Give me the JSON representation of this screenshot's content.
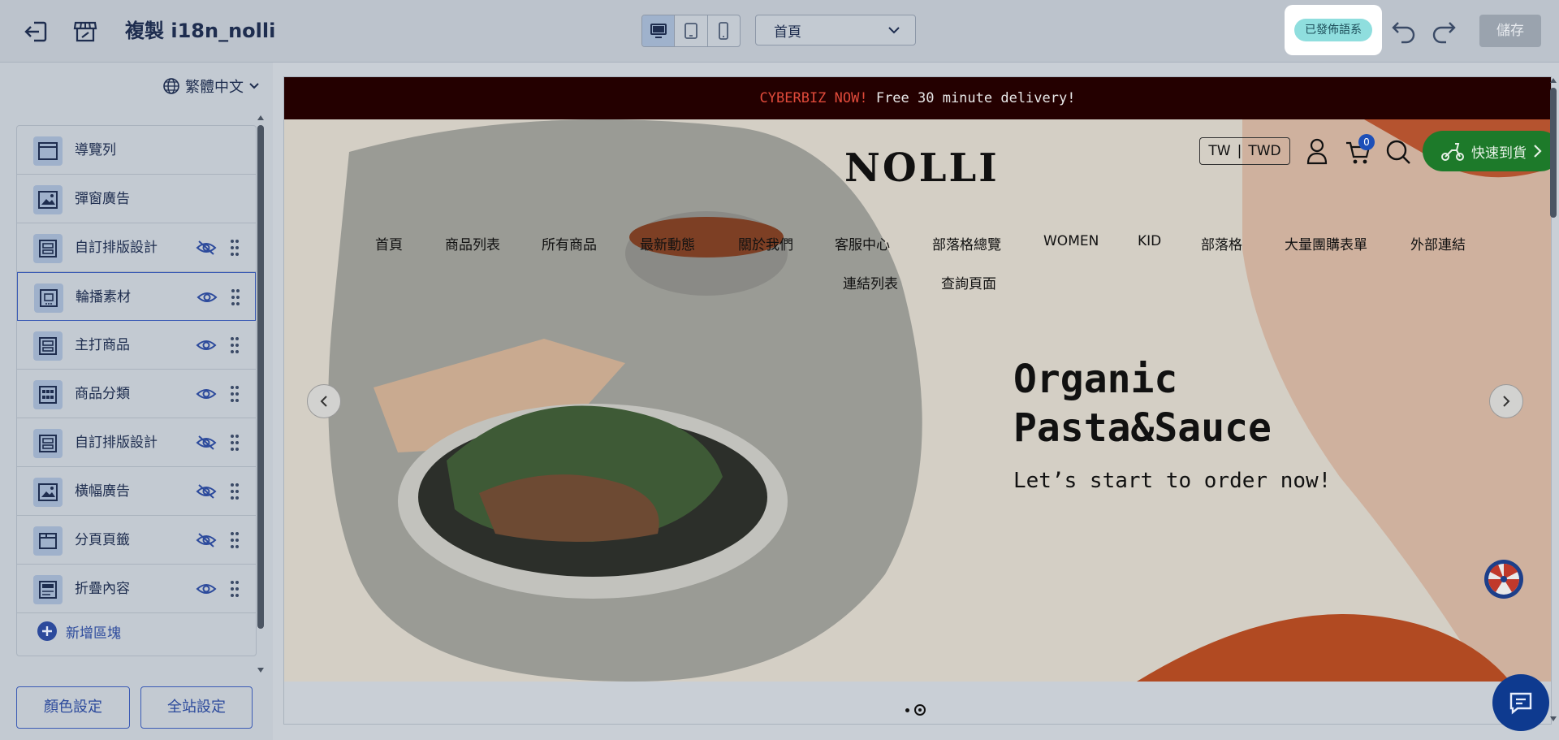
{
  "header": {
    "title": "複製 i18n_nolli",
    "page_select": "首頁",
    "published_badge": "已發佈語系",
    "save_label": "儲存"
  },
  "sidebar": {
    "language": "繁體中文",
    "items": [
      {
        "label": "導覽列",
        "icon": "navbar-icon"
      },
      {
        "label": "彈窗廣告",
        "icon": "image-icon"
      },
      {
        "label": "自訂排版設計",
        "icon": "layout-icon",
        "visible": false
      },
      {
        "label": "輪播素材",
        "icon": "carousel-icon",
        "visible": true
      },
      {
        "label": "主打商品",
        "icon": "layout-icon",
        "visible": true
      },
      {
        "label": "商品分類",
        "icon": "grid-icon",
        "visible": true
      },
      {
        "label": "自訂排版設計",
        "icon": "layout-icon",
        "visible": false
      },
      {
        "label": "橫幅廣告",
        "icon": "image-icon",
        "visible": false
      },
      {
        "label": "分頁頁籤",
        "icon": "tab-icon",
        "visible": false
      },
      {
        "label": "折疊內容",
        "icon": "accordion-icon",
        "visible": true
      }
    ],
    "add_block": "新增區塊",
    "color_settings": "顏色設定",
    "site_settings": "全站設定"
  },
  "preview": {
    "announcement_highlight": "CYBERBIZ NOW!",
    "announcement_text": " Free 30 minute delivery!",
    "logo": "NOLLI",
    "currency_lang": "TW",
    "currency": "TWD",
    "cart_count": "0",
    "fast_delivery": "快速到貨",
    "nav": [
      "首頁",
      "商品列表",
      "所有商品",
      "最新動態",
      "關於我們",
      "客服中心",
      "部落格總覽",
      "WOMEN",
      "KID",
      "部落格",
      "大量團購表單",
      "外部連結"
    ],
    "nav_row2": [
      "連結列表",
      "查詢頁面"
    ],
    "hero_title_line1": "Organic",
    "hero_title_line2": "Pasta&Sauce",
    "hero_subtitle": "Let’s start to order now!"
  },
  "colors": {
    "accent": "#3b5bb5",
    "badge": "#8fdede",
    "announcement_bg": "#240000",
    "fast_delivery_bg": "#1d7a2a",
    "chat_bg": "#0e3a8f"
  }
}
